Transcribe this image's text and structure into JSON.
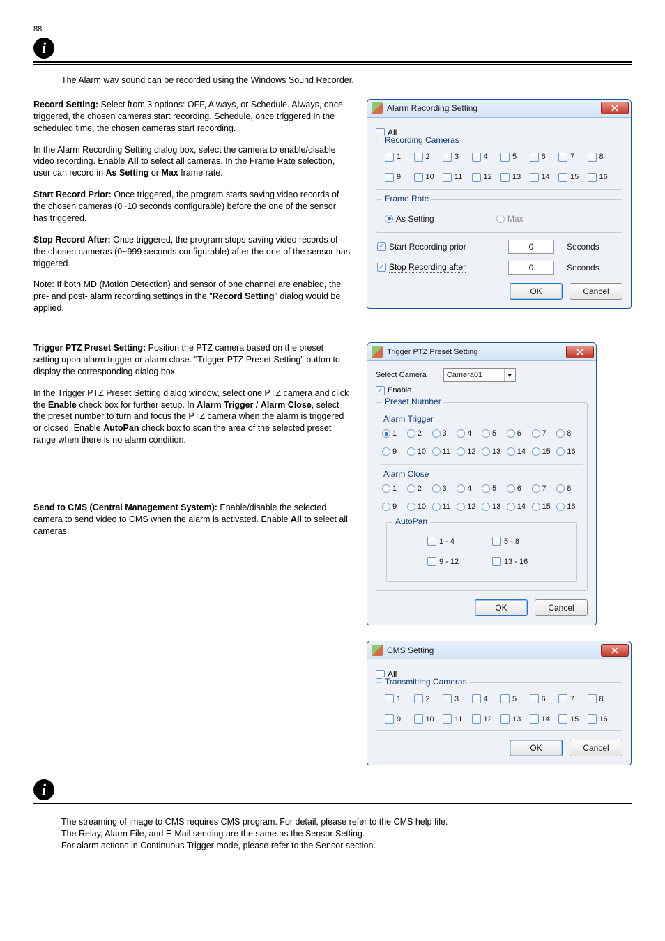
{
  "page_number": "88",
  "info1": "The Alarm wav sound can be recorded using the Windows Sound Recorder.",
  "section1": {
    "lead_bold": "Record Setting:",
    "lead_rest": " Select from 3 options: OFF, Always, or Schedule. Always, once triggered, the chosen cameras start recording. Schedule, once triggered in the scheduled time, the chosen cameras start recording.",
    "p2_head": "In the Alarm Recording Setting dialog box, select the camera to enable/disable video recording. Enable ",
    "p2_bold1": "All",
    "p2_mid": " to select all cameras. In the Frame Rate selection, user can record in ",
    "p2_bold2": "As Setting",
    "p2_after2": " or ",
    "p2_bold3": "Max",
    "p2_tail": " frame rate.",
    "p3_bold": "Start Record Prior:",
    "p3_rest1": " Once triggered, the program starts saving video records of the chosen cameras (0~10 seconds configurable) before the one of the sensor has triggered.",
    "p4_bold": "Stop Record After:",
    "p4_rest1": " Once triggered, the program stops saving video records of the chosen cameras (0~999 seconds configurable) after the one of the sensor has triggered.",
    "note_before": "Note: If both MD (Motion Detection) and sensor of one channel are enabled, the pre- and post- alarm recording settings in the \"",
    "note_bold": "Record Setting",
    "note_after": "\" dialog would be applied."
  },
  "section2": {
    "lead_bold": "Trigger PTZ Preset Setting:",
    "lead_rest": " Position the PTZ camera based on the preset setting upon alarm trigger or alarm close. \"Trigger PTZ Preset Setting\" button to display the corresponding dialog box.",
    "p2_head": "In the Trigger PTZ Preset Setting dialog window, select one PTZ camera and click the ",
    "p2_bold1": "Enable",
    "p2_mid1": " check box for further setup. In ",
    "p2_bold2": "Alarm Trigger",
    "p2_mid2": " / ",
    "p2_bold3": "Alarm Close",
    "p2_mid3": ", select the preset number to turn and focus the PTZ camera when the alarm is triggered or closed. Enable ",
    "p2_bold4": "AutoPan",
    "p2_tail": " check box to scan the area of the selected preset range when there is no alarm condition.",
    "p3_1": "Send to CMS (Central Management System):",
    "p3_rest": " Enable/disable the selected camera to send video to CMS when the alarm is activated. Enable ",
    "p3_bold_all": "All",
    "p3_rest2": " to select all cameras."
  },
  "info2": {
    "line1": "The streaming of image to CMS requires CMS program. For detail, please refer to the CMS help file.",
    "line2": "The Relay, Alarm File, and E-Mail sending are the same as the Sensor Setting.",
    "line3": "For alarm actions in Continuous Trigger mode, please refer to the Sensor section."
  },
  "dialog1": {
    "title": "Alarm Recording Setting",
    "all": "All",
    "group": "Recording Cameras",
    "cameras_row1": [
      "1",
      "2",
      "3",
      "4",
      "5",
      "6",
      "7",
      "8"
    ],
    "cameras_row2": [
      "9",
      "10",
      "11",
      "12",
      "13",
      "14",
      "15",
      "16"
    ],
    "framerate": "Frame Rate",
    "as_setting": "As Setting",
    "max": "Max",
    "start_label": "Start Recording prior",
    "stop_label": "Stop Recording after",
    "start_val": "0",
    "stop_val": "0",
    "seconds": "Seconds",
    "ok": "OK",
    "cancel": "Cancel"
  },
  "dialog2": {
    "title": "Trigger PTZ Preset Setting",
    "select_camera": "Select Camera",
    "camera_value": "Camera01",
    "enable": "Enable",
    "preset_number": "Preset Number",
    "alarm_trigger": "Alarm Trigger",
    "alarm_close": "Alarm Close",
    "row1": [
      "1",
      "2",
      "3",
      "4",
      "5",
      "6",
      "7",
      "8"
    ],
    "row2": [
      "9",
      "10",
      "11",
      "12",
      "13",
      "14",
      "15",
      "16"
    ],
    "autopan": "AutoPan",
    "ap1": "1 - 4",
    "ap2": "5 - 8",
    "ap3": "9 - 12",
    "ap4": "13 - 16",
    "ok": "OK",
    "cancel": "Cancel"
  },
  "dialog3": {
    "title": "CMS Setting",
    "all": "All",
    "group": "Transmitting Cameras",
    "row1": [
      "1",
      "2",
      "3",
      "4",
      "5",
      "6",
      "7",
      "8"
    ],
    "row2": [
      "9",
      "10",
      "11",
      "12",
      "13",
      "14",
      "15",
      "16"
    ],
    "ok": "OK",
    "cancel": "Cancel"
  }
}
